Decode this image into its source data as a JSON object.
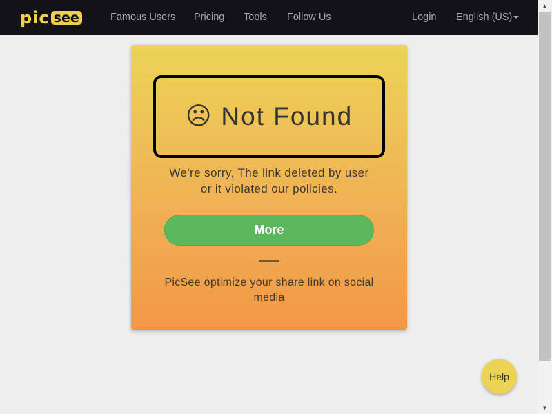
{
  "nav": {
    "logo": {
      "part1": "pic",
      "part2": "see"
    },
    "links": [
      "Famous Users",
      "Pricing",
      "Tools",
      "Follow Us"
    ],
    "login": "Login",
    "language": "English (US)"
  },
  "card": {
    "face_icon": "☹",
    "title": "Not Found",
    "message_line1": "We're sorry, The link deleted by user",
    "message_line2": "or it violated our policies.",
    "button": "More",
    "tagline_line1": "PicSee optimize your share link on social",
    "tagline_line2": "media"
  },
  "help": {
    "label": "Help"
  },
  "scrollbar": {
    "up_arrow": "▲",
    "down_arrow": "▼"
  },
  "colors": {
    "navbar": "#121218",
    "brand_yellow": "#f0cf4f",
    "card_top": "#ecd356",
    "card_bottom": "#f29747",
    "button_green": "#5cb85c"
  },
  "icons": {
    "face": "sad-face-icon",
    "caret": "caret-down-icon"
  }
}
